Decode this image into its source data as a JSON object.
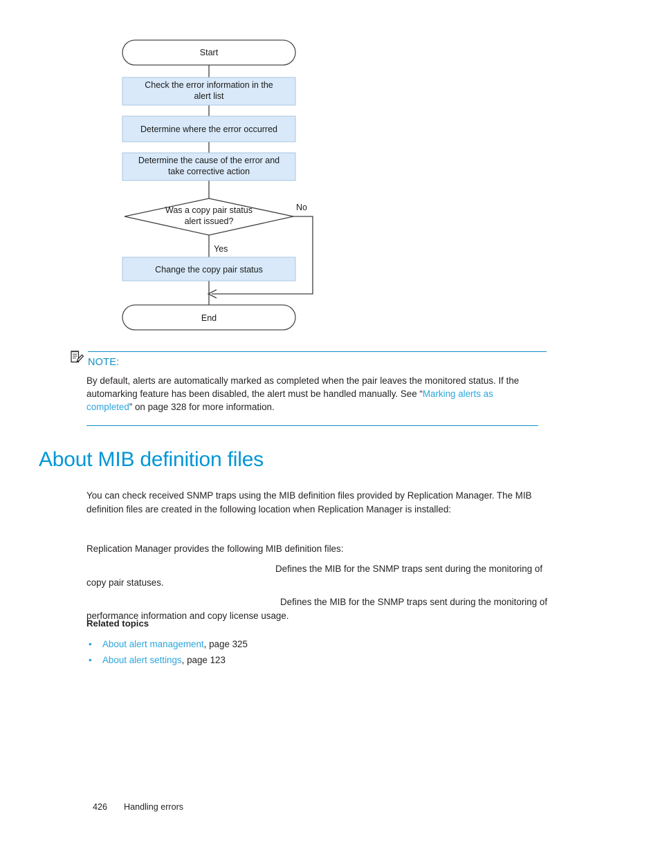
{
  "flowchart": {
    "start_label": "Start",
    "end_label": "End",
    "steps": [
      "Check the error information in the alert list",
      "Determine where the error occurred",
      "Determine the cause of the error and take corrective action",
      "Change the copy pair status"
    ],
    "step1_line1": "Check the error information in the",
    "step1_line2": "alert list",
    "step2_line1": "Determine where the error occurred",
    "step3_line1": "Determine the cause of the error and",
    "step3_line2": "take corrective action",
    "step4_line1": "Change the copy pair status",
    "decision_line1": "Was a copy pair status",
    "decision_line2": "alert issued?",
    "branch_yes": "Yes",
    "branch_no": "No",
    "box_fill": "#d9e9f9",
    "box_stroke": "#7f7f7f",
    "line_color": "#3f3f3f"
  },
  "note": {
    "icon": "note-pencil-icon",
    "title": "NOTE:",
    "text_before_link": "By default, alerts are automatically marked as completed when the pair leaves the monitored status. If the automarking feature has been disabled, the alert must be handled manually. See “",
    "link_text": "Marking alerts as completed",
    "text_after_link": "” on page 328 for more information.",
    "rule_color": "#0e8ec4",
    "title_color": "#0f8fc6"
  },
  "section": {
    "heading": "About MIB definition files",
    "heading_color": "#0096d6",
    "intro": "You can check received SNMP traps using the MIB definition files provided by Replication Manager. The MIB definition files are created in the following location when Replication Manager is installed:",
    "provides": "Replication Manager provides the following MIB definition files:",
    "file1_desc": "Defines the MIB for the SNMP traps sent during the monitoring of copy pair statuses.",
    "file2_desc": "Defines the MIB for the SNMP traps sent during the monitoring of performance information and copy license usage."
  },
  "related": {
    "title": "Related topics",
    "bullet": "•",
    "items": [
      {
        "link": "About alert management",
        "page": ", page 325"
      },
      {
        "link": "About alert settings",
        "page": ", page 123"
      }
    ],
    "link_color": "#2ba6dd"
  },
  "footer": {
    "page_number": "426",
    "chapter": "Handling errors"
  }
}
